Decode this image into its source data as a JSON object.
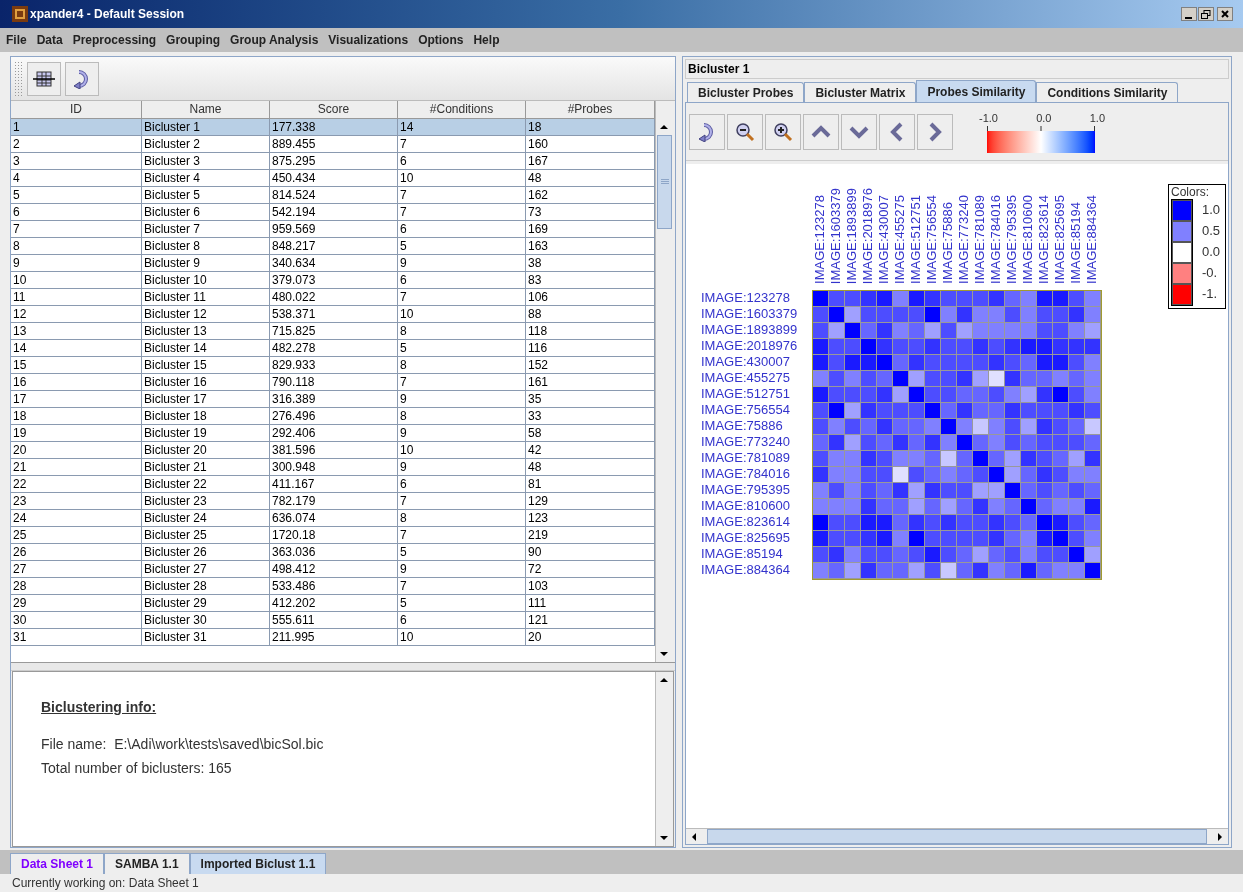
{
  "window": {
    "title": "xpander4 - Default Session"
  },
  "menu": [
    "File",
    "Data",
    "Preprocessing",
    "Grouping",
    "Group Analysis",
    "Visualizations",
    "Options",
    "Help"
  ],
  "table": {
    "columns": [
      "ID",
      "Name",
      "Score",
      "#Conditions",
      "#Probes"
    ],
    "rows": [
      {
        "cells": [
          "1",
          "Bicluster 1",
          "177.338",
          "14",
          "18"
        ],
        "selected": true
      },
      {
        "cells": [
          "2",
          "Bicluster 2",
          "889.455",
          "7",
          "160"
        ],
        "selected": false
      },
      {
        "cells": [
          "3",
          "Bicluster 3",
          "875.295",
          "6",
          "167"
        ],
        "selected": false
      },
      {
        "cells": [
          "4",
          "Bicluster 4",
          "450.434",
          "10",
          "48"
        ],
        "selected": false
      },
      {
        "cells": [
          "5",
          "Bicluster 5",
          "814.524",
          "7",
          "162"
        ],
        "selected": false
      },
      {
        "cells": [
          "6",
          "Bicluster 6",
          "542.194",
          "7",
          "73"
        ],
        "selected": false
      },
      {
        "cells": [
          "7",
          "Bicluster 7",
          "959.569",
          "6",
          "169"
        ],
        "selected": false
      },
      {
        "cells": [
          "8",
          "Bicluster 8",
          "848.217",
          "5",
          "163"
        ],
        "selected": false
      },
      {
        "cells": [
          "9",
          "Bicluster 9",
          "340.634",
          "9",
          "38"
        ],
        "selected": false
      },
      {
        "cells": [
          "10",
          "Bicluster 10",
          "379.073",
          "6",
          "83"
        ],
        "selected": false
      },
      {
        "cells": [
          "11",
          "Bicluster 11",
          "480.022",
          "7",
          "106"
        ],
        "selected": false
      },
      {
        "cells": [
          "12",
          "Bicluster 12",
          "538.371",
          "10",
          "88"
        ],
        "selected": false
      },
      {
        "cells": [
          "13",
          "Bicluster 13",
          "715.825",
          "8",
          "118"
        ],
        "selected": false
      },
      {
        "cells": [
          "14",
          "Bicluster 14",
          "482.278",
          "5",
          "116"
        ],
        "selected": false
      },
      {
        "cells": [
          "15",
          "Bicluster 15",
          "829.933",
          "8",
          "152"
        ],
        "selected": false
      },
      {
        "cells": [
          "16",
          "Bicluster 16",
          "790.118",
          "7",
          "161"
        ],
        "selected": false
      },
      {
        "cells": [
          "17",
          "Bicluster 17",
          "316.389",
          "9",
          "35"
        ],
        "selected": false
      },
      {
        "cells": [
          "18",
          "Bicluster 18",
          "276.496",
          "8",
          "33"
        ],
        "selected": false
      },
      {
        "cells": [
          "19",
          "Bicluster 19",
          "292.406",
          "9",
          "58"
        ],
        "selected": false
      },
      {
        "cells": [
          "20",
          "Bicluster 20",
          "381.596",
          "10",
          "42"
        ],
        "selected": false
      },
      {
        "cells": [
          "21",
          "Bicluster 21",
          "300.948",
          "9",
          "48"
        ],
        "selected": false
      },
      {
        "cells": [
          "22",
          "Bicluster 22",
          "411.167",
          "6",
          "81"
        ],
        "selected": false
      },
      {
        "cells": [
          "23",
          "Bicluster 23",
          "782.179",
          "7",
          "129"
        ],
        "selected": false
      },
      {
        "cells": [
          "24",
          "Bicluster 24",
          "636.074",
          "8",
          "123"
        ],
        "selected": false
      },
      {
        "cells": [
          "25",
          "Bicluster 25",
          "1720.18",
          "7",
          "219"
        ],
        "selected": false
      },
      {
        "cells": [
          "26",
          "Bicluster 26",
          "363.036",
          "5",
          "90"
        ],
        "selected": false
      },
      {
        "cells": [
          "27",
          "Bicluster 27",
          "498.412",
          "9",
          "72"
        ],
        "selected": false
      },
      {
        "cells": [
          "28",
          "Bicluster 28",
          "533.486",
          "7",
          "103"
        ],
        "selected": false
      },
      {
        "cells": [
          "29",
          "Bicluster 29",
          "412.202",
          "5",
          "111"
        ],
        "selected": false
      },
      {
        "cells": [
          "30",
          "Bicluster 30",
          "555.611",
          "6",
          "121"
        ],
        "selected": false
      },
      {
        "cells": [
          "31",
          "Bicluster 31",
          "211.995",
          "10",
          "20"
        ],
        "selected": false
      }
    ]
  },
  "info": {
    "heading": "Biclustering info:",
    "lines": [
      "File name:  E:\\Adi\\work\\tests\\saved\\bicSol.bic",
      "Total number of biclusters: 165"
    ]
  },
  "panel_title": "Bicluster 1",
  "tabs": [
    {
      "label": "Bicluster Probes",
      "selected": false
    },
    {
      "label": "Bicluster Matrix",
      "selected": false
    },
    {
      "label": "Probes Similarity",
      "selected": true
    },
    {
      "label": "Conditions Similarity",
      "selected": false
    }
  ],
  "scale_ticks": [
    "-1.0",
    "0.0",
    "1.0"
  ],
  "heatmap": {
    "columns": [
      "IMAGE:123278",
      "IMAGE:1603379",
      "IMAGE:1893899",
      "IMAGE:2018976",
      "IMAGE:430007",
      "IMAGE:455275",
      "IMAGE:512751",
      "IMAGE:756554",
      "IMAGE:75886",
      "IMAGE:773240",
      "IMAGE:781089",
      "IMAGE:784016",
      "IMAGE:795395",
      "IMAGE:810600",
      "IMAGE:823614",
      "IMAGE:825695",
      "IMAGE:85194",
      "IMAGE:884364"
    ],
    "rows": [
      {
        "label": "IMAGE:123278",
        "cells": [
          {
            "color": "#0000ff"
          },
          {
            "color": "#4d4dff"
          },
          {
            "color": "#4d4dff"
          },
          {
            "color": "#3333ff"
          },
          {
            "color": "#1a1aff"
          },
          {
            "color": "#8080ff"
          },
          {
            "color": "#1a1aff"
          },
          {
            "color": "#3333ff"
          },
          {
            "color": "#4d4dff"
          },
          {
            "color": "#4d4dff"
          },
          {
            "color": "#4d4dff"
          },
          {
            "color": "#3333ff"
          },
          {
            "color": "#6666ff"
          },
          {
            "color": "#8080ff"
          },
          {
            "color": "#1a1aff"
          },
          {
            "color": "#1a1aff"
          },
          {
            "color": "#4d4dff"
          },
          {
            "color": "#8080ff"
          }
        ]
      },
      {
        "label": "IMAGE:1603379",
        "cells": [
          {
            "color": "#4d4dff"
          },
          {
            "color": "#0000ff"
          },
          {
            "color": "#a0a0ff"
          },
          {
            "color": "#4d4dff"
          },
          {
            "color": "#4d4dff"
          },
          {
            "color": "#4d4dff"
          },
          {
            "color": "#4d4dff"
          },
          {
            "color": "#0000ff"
          },
          {
            "color": "#8080ff"
          },
          {
            "color": "#3333ff"
          },
          {
            "color": "#8080ff"
          },
          {
            "color": "#8080ff"
          },
          {
            "color": "#4d4dff"
          },
          {
            "color": "#8080ff"
          },
          {
            "color": "#4d4dff"
          },
          {
            "color": "#4d4dff"
          },
          {
            "color": "#3333ff"
          },
          {
            "color": "#8080ff"
          }
        ]
      },
      {
        "label": "IMAGE:1893899",
        "cells": [
          {
            "color": "#4d4dff"
          },
          {
            "color": "#a0a0ff"
          },
          {
            "color": "#0000ff"
          },
          {
            "color": "#6666ff"
          },
          {
            "color": "#3333ff"
          },
          {
            "color": "#8080ff"
          },
          {
            "color": "#6666ff"
          },
          {
            "color": "#a0a0ff"
          },
          {
            "color": "#4d4dff"
          },
          {
            "color": "#a0a0ff"
          },
          {
            "color": "#8080ff"
          },
          {
            "color": "#8080ff"
          },
          {
            "color": "#8080ff"
          },
          {
            "color": "#8080ff"
          },
          {
            "color": "#4d4dff"
          },
          {
            "color": "#4d4dff"
          },
          {
            "color": "#8080ff"
          },
          {
            "color": "#a0a0ff"
          }
        ]
      },
      {
        "label": "IMAGE:2018976",
        "cells": [
          {
            "color": "#1a1aff"
          },
          {
            "color": "#4d4dff"
          },
          {
            "color": "#4d4dff"
          },
          {
            "color": "#0000ff"
          },
          {
            "color": "#3333ff"
          },
          {
            "color": "#4d4dff"
          },
          {
            "color": "#4d4dff"
          },
          {
            "color": "#3333ff"
          },
          {
            "color": "#4d4dff"
          },
          {
            "color": "#4d4dff"
          },
          {
            "color": "#3333ff"
          },
          {
            "color": "#4d4dff"
          },
          {
            "color": "#3333ff"
          },
          {
            "color": "#1a1aff"
          },
          {
            "color": "#1a1aff"
          },
          {
            "color": "#3333ff"
          },
          {
            "color": "#3333ff"
          },
          {
            "color": "#3333ff"
          }
        ]
      },
      {
        "label": "IMAGE:430007",
        "cells": [
          {
            "color": "#1a1aff"
          },
          {
            "color": "#4d4dff"
          },
          {
            "color": "#1a1aff"
          },
          {
            "color": "#1a1aff"
          },
          {
            "color": "#0000ff"
          },
          {
            "color": "#6666ff"
          },
          {
            "color": "#3333ff"
          },
          {
            "color": "#4d4dff"
          },
          {
            "color": "#4d4dff"
          },
          {
            "color": "#4d4dff"
          },
          {
            "color": "#4d4dff"
          },
          {
            "color": "#3333ff"
          },
          {
            "color": "#4d4dff"
          },
          {
            "color": "#6666ff"
          },
          {
            "color": "#1a1aff"
          },
          {
            "color": "#1a1aff"
          },
          {
            "color": "#4d4dff"
          },
          {
            "color": "#8080ff"
          }
        ]
      },
      {
        "label": "IMAGE:455275",
        "cells": [
          {
            "color": "#8080ff"
          },
          {
            "color": "#4d4dff"
          },
          {
            "color": "#8080ff"
          },
          {
            "color": "#4d4dff"
          },
          {
            "color": "#6666ff"
          },
          {
            "color": "#0000ff"
          },
          {
            "color": "#a0a0ff"
          },
          {
            "color": "#4d4dff"
          },
          {
            "color": "#4d4dff"
          },
          {
            "color": "#3333ff"
          },
          {
            "color": "#a0a0ff"
          },
          {
            "color": "#e0e0ff"
          },
          {
            "color": "#3333ff"
          },
          {
            "color": "#6666ff"
          },
          {
            "color": "#6666ff"
          },
          {
            "color": "#8080ff"
          },
          {
            "color": "#6666ff"
          },
          {
            "color": "#8080ff"
          }
        ]
      },
      {
        "label": "IMAGE:512751",
        "cells": [
          {
            "color": "#1a1aff"
          },
          {
            "color": "#4d4dff"
          },
          {
            "color": "#4d4dff"
          },
          {
            "color": "#4d4dff"
          },
          {
            "color": "#3333ff"
          },
          {
            "color": "#a0a0ff"
          },
          {
            "color": "#0000ff"
          },
          {
            "color": "#4d4dff"
          },
          {
            "color": "#4d4dff"
          },
          {
            "color": "#6666ff"
          },
          {
            "color": "#6666ff"
          },
          {
            "color": "#4d4dff"
          },
          {
            "color": "#8080ff"
          },
          {
            "color": "#a0a0ff"
          },
          {
            "color": "#3333ff"
          },
          {
            "color": "#0000ff"
          },
          {
            "color": "#4d4dff"
          },
          {
            "color": "#8080ff"
          }
        ]
      },
      {
        "label": "IMAGE:756554",
        "cells": [
          {
            "color": "#4d4dff"
          },
          {
            "color": "#0000ff"
          },
          {
            "color": "#a0a0ff"
          },
          {
            "color": "#3333ff"
          },
          {
            "color": "#4d4dff"
          },
          {
            "color": "#4d4dff"
          },
          {
            "color": "#4d4dff"
          },
          {
            "color": "#0000ff"
          },
          {
            "color": "#6666ff"
          },
          {
            "color": "#3333ff"
          },
          {
            "color": "#6666ff"
          },
          {
            "color": "#6666ff"
          },
          {
            "color": "#3333ff"
          },
          {
            "color": "#4d4dff"
          },
          {
            "color": "#4d4dff"
          },
          {
            "color": "#4d4dff"
          },
          {
            "color": "#3333ff"
          },
          {
            "color": "#4d4dff"
          }
        ]
      },
      {
        "label": "IMAGE:75886",
        "cells": [
          {
            "color": "#4d4dff"
          },
          {
            "color": "#8080ff"
          },
          {
            "color": "#4d4dff"
          },
          {
            "color": "#6666ff"
          },
          {
            "color": "#3333ff"
          },
          {
            "color": "#6666ff"
          },
          {
            "color": "#6666ff"
          },
          {
            "color": "#8080ff"
          },
          {
            "color": "#0000ff"
          },
          {
            "color": "#8080ff"
          },
          {
            "color": "#c8c8ff"
          },
          {
            "color": "#8080ff"
          },
          {
            "color": "#4d4dff"
          },
          {
            "color": "#a0a0ff"
          },
          {
            "color": "#3333ff"
          },
          {
            "color": "#4d4dff"
          },
          {
            "color": "#6666ff"
          },
          {
            "color": "#c8c8ff"
          }
        ]
      },
      {
        "label": "IMAGE:773240",
        "cells": [
          {
            "color": "#6666ff"
          },
          {
            "color": "#3333ff"
          },
          {
            "color": "#a0a0ff"
          },
          {
            "color": "#4d4dff"
          },
          {
            "color": "#6666ff"
          },
          {
            "color": "#3333ff"
          },
          {
            "color": "#6666ff"
          },
          {
            "color": "#3333ff"
          },
          {
            "color": "#8080ff"
          },
          {
            "color": "#0000ff"
          },
          {
            "color": "#6666ff"
          },
          {
            "color": "#8080ff"
          },
          {
            "color": "#4d4dff"
          },
          {
            "color": "#6666ff"
          },
          {
            "color": "#4d4dff"
          },
          {
            "color": "#4d4dff"
          },
          {
            "color": "#4d4dff"
          },
          {
            "color": "#6666ff"
          }
        ]
      },
      {
        "label": "IMAGE:781089",
        "cells": [
          {
            "color": "#4d4dff"
          },
          {
            "color": "#8080ff"
          },
          {
            "color": "#8080ff"
          },
          {
            "color": "#3333ff"
          },
          {
            "color": "#4d4dff"
          },
          {
            "color": "#8080ff"
          },
          {
            "color": "#8080ff"
          },
          {
            "color": "#6666ff"
          },
          {
            "color": "#c8c8ff"
          },
          {
            "color": "#6666ff"
          },
          {
            "color": "#0000ff"
          },
          {
            "color": "#6666ff"
          },
          {
            "color": "#a0a0ff"
          },
          {
            "color": "#3333ff"
          },
          {
            "color": "#4d4dff"
          },
          {
            "color": "#6666ff"
          },
          {
            "color": "#a0a0ff"
          },
          {
            "color": "#3333ff"
          }
        ]
      },
      {
        "label": "IMAGE:784016",
        "cells": [
          {
            "color": "#3333ff"
          },
          {
            "color": "#8080ff"
          },
          {
            "color": "#8080ff"
          },
          {
            "color": "#4d4dff"
          },
          {
            "color": "#4d4dff"
          },
          {
            "color": "#e0e0ff"
          },
          {
            "color": "#4d4dff"
          },
          {
            "color": "#6666ff"
          },
          {
            "color": "#8080ff"
          },
          {
            "color": "#6666ff"
          },
          {
            "color": "#4d4dff"
          },
          {
            "color": "#0000ff"
          },
          {
            "color": "#a0a0ff"
          },
          {
            "color": "#6666ff"
          },
          {
            "color": "#3333ff"
          },
          {
            "color": "#4d4dff"
          },
          {
            "color": "#8080ff"
          },
          {
            "color": "#8080ff"
          }
        ]
      },
      {
        "label": "IMAGE:795395",
        "cells": [
          {
            "color": "#8080ff"
          },
          {
            "color": "#4d4dff"
          },
          {
            "color": "#8080ff"
          },
          {
            "color": "#4d4dff"
          },
          {
            "color": "#6666ff"
          },
          {
            "color": "#3333ff"
          },
          {
            "color": "#a0a0ff"
          },
          {
            "color": "#3333ff"
          },
          {
            "color": "#4d4dff"
          },
          {
            "color": "#4d4dff"
          },
          {
            "color": "#a0a0ff"
          },
          {
            "color": "#a0a0ff"
          },
          {
            "color": "#0000ff"
          },
          {
            "color": "#6666ff"
          },
          {
            "color": "#4d4dff"
          },
          {
            "color": "#6666ff"
          },
          {
            "color": "#4d4dff"
          },
          {
            "color": "#6666ff"
          }
        ]
      },
      {
        "label": "IMAGE:810600",
        "cells": [
          {
            "color": "#8080ff"
          },
          {
            "color": "#8080ff"
          },
          {
            "color": "#8080ff"
          },
          {
            "color": "#3333ff"
          },
          {
            "color": "#6666ff"
          },
          {
            "color": "#6666ff"
          },
          {
            "color": "#a0a0ff"
          },
          {
            "color": "#6666ff"
          },
          {
            "color": "#a0a0ff"
          },
          {
            "color": "#6666ff"
          },
          {
            "color": "#3333ff"
          },
          {
            "color": "#8080ff"
          },
          {
            "color": "#6666ff"
          },
          {
            "color": "#0000ff"
          },
          {
            "color": "#6666ff"
          },
          {
            "color": "#8080ff"
          },
          {
            "color": "#8080ff"
          },
          {
            "color": "#1a1aff"
          }
        ]
      },
      {
        "label": "IMAGE:823614",
        "cells": [
          {
            "color": "#0000ff"
          },
          {
            "color": "#4d4dff"
          },
          {
            "color": "#4d4dff"
          },
          {
            "color": "#1a1aff"
          },
          {
            "color": "#1a1aff"
          },
          {
            "color": "#6666ff"
          },
          {
            "color": "#3333ff"
          },
          {
            "color": "#4d4dff"
          },
          {
            "color": "#3333ff"
          },
          {
            "color": "#4d4dff"
          },
          {
            "color": "#4d4dff"
          },
          {
            "color": "#3333ff"
          },
          {
            "color": "#4d4dff"
          },
          {
            "color": "#6666ff"
          },
          {
            "color": "#0000ff"
          },
          {
            "color": "#1a1aff"
          },
          {
            "color": "#4d4dff"
          },
          {
            "color": "#6666ff"
          }
        ]
      },
      {
        "label": "IMAGE:825695",
        "cells": [
          {
            "color": "#1a1aff"
          },
          {
            "color": "#4d4dff"
          },
          {
            "color": "#4d4dff"
          },
          {
            "color": "#3333ff"
          },
          {
            "color": "#1a1aff"
          },
          {
            "color": "#8080ff"
          },
          {
            "color": "#0000ff"
          },
          {
            "color": "#4d4dff"
          },
          {
            "color": "#4d4dff"
          },
          {
            "color": "#4d4dff"
          },
          {
            "color": "#4d4dff"
          },
          {
            "color": "#3333ff"
          },
          {
            "color": "#6666ff"
          },
          {
            "color": "#8080ff"
          },
          {
            "color": "#1a1aff"
          },
          {
            "color": "#0000ff"
          },
          {
            "color": "#4d4dff"
          },
          {
            "color": "#8080ff"
          }
        ]
      },
      {
        "label": "IMAGE:85194",
        "cells": [
          {
            "color": "#4d4dff"
          },
          {
            "color": "#3333ff"
          },
          {
            "color": "#8080ff"
          },
          {
            "color": "#4d4dff"
          },
          {
            "color": "#4d4dff"
          },
          {
            "color": "#6666ff"
          },
          {
            "color": "#4d4dff"
          },
          {
            "color": "#1a1aff"
          },
          {
            "color": "#4d4dff"
          },
          {
            "color": "#6666ff"
          },
          {
            "color": "#a0a0ff"
          },
          {
            "color": "#6666ff"
          },
          {
            "color": "#4d4dff"
          },
          {
            "color": "#8080ff"
          },
          {
            "color": "#4d4dff"
          },
          {
            "color": "#4d4dff"
          },
          {
            "color": "#0000ff"
          },
          {
            "color": "#a0a0ff"
          }
        ]
      },
      {
        "label": "IMAGE:884364",
        "cells": [
          {
            "color": "#8080ff"
          },
          {
            "color": "#6666ff"
          },
          {
            "color": "#a0a0ff"
          },
          {
            "color": "#3333ff"
          },
          {
            "color": "#6666ff"
          },
          {
            "color": "#6666ff"
          },
          {
            "color": "#a0a0ff"
          },
          {
            "color": "#4d4dff"
          },
          {
            "color": "#c8c8ff"
          },
          {
            "color": "#6666ff"
          },
          {
            "color": "#3333ff"
          },
          {
            "color": "#8080ff"
          },
          {
            "color": "#6666ff"
          },
          {
            "color": "#1a1aff"
          },
          {
            "color": "#6666ff"
          },
          {
            "color": "#8080ff"
          },
          {
            "color": "#8080ff"
          },
          {
            "color": "#0000ff"
          }
        ]
      }
    ]
  },
  "legend": {
    "title": "Colors:",
    "items": [
      {
        "label": "1.0",
        "color": "#0000ff"
      },
      {
        "label": "0.5",
        "color": "#8080ff"
      },
      {
        "label": "0.0",
        "color": "#ffffff"
      },
      {
        "label": "-0.",
        "color": "#ff8080"
      },
      {
        "label": "-1.",
        "color": "#ff0000"
      }
    ]
  },
  "sheet_tabs": [
    {
      "label": "Data Sheet 1",
      "selected": false,
      "highlighted": true
    },
    {
      "label": "SAMBA 1.1",
      "selected": false,
      "highlighted": false
    },
    {
      "label": "Imported Biclust 1.1",
      "selected": true,
      "highlighted": false
    }
  ],
  "status_bar": "Currently working on: Data Sheet 1"
}
